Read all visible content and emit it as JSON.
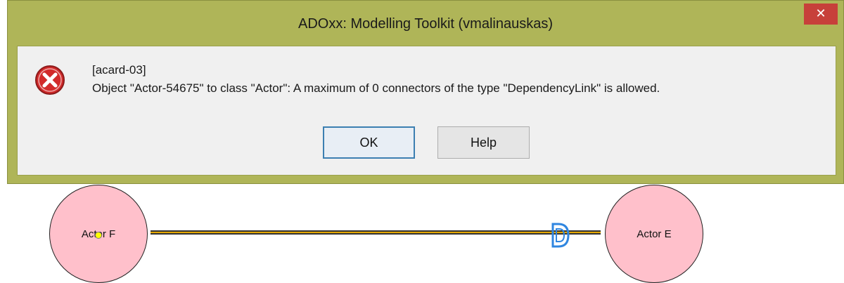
{
  "dialog": {
    "title": "ADOxx: Modelling Toolkit (vmalinauskas)",
    "close_glyph": "✕",
    "message_code": "[acard-03]",
    "message_text": "Object \"Actor-54675\" to class \"Actor\": A maximum of 0 connectors of the type \"DependencyLink\" is allowed.",
    "icon": "error-icon",
    "buttons": {
      "ok_label": "OK",
      "help_label": "Help"
    },
    "colors": {
      "title_bar": "#afb558",
      "close_button": "#c7403a",
      "error_icon": "#d22a2a",
      "default_button_border": "#3c7fb1"
    }
  },
  "diagram": {
    "actors": [
      {
        "label": "Actor F"
      },
      {
        "label": "Actor E"
      }
    ],
    "connector_type": "DependencyLink",
    "colors": {
      "actor_fill": "#ffc0cb",
      "connector_fill": "#e6a800",
      "marker": "#2f86e0"
    }
  }
}
